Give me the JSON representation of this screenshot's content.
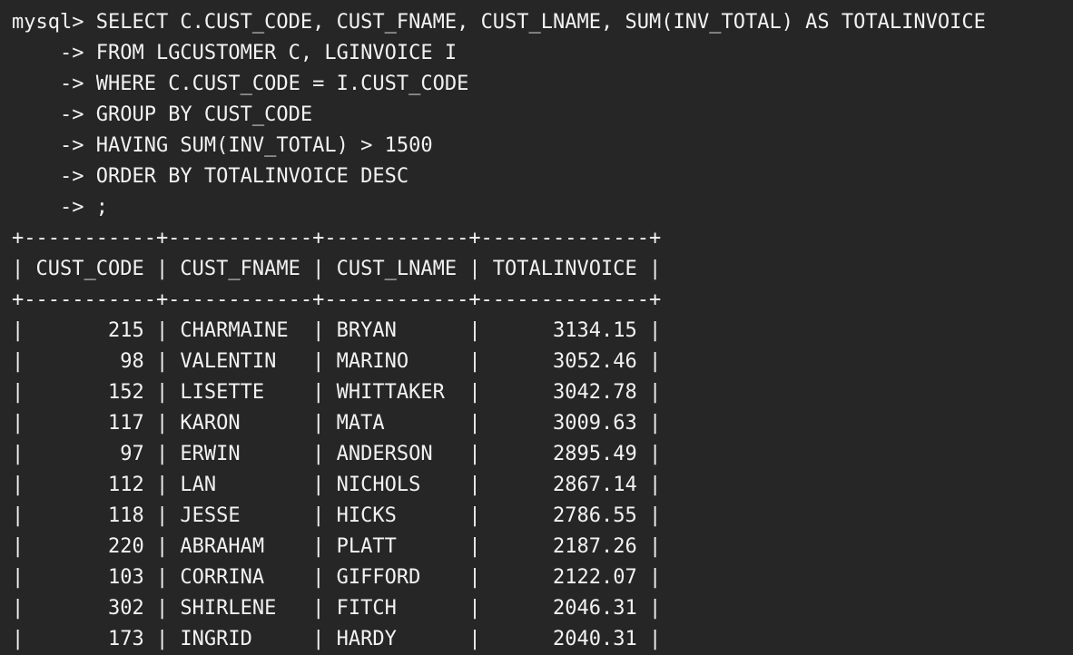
{
  "terminal": {
    "prompt": "mysql> ",
    "continuation_prompt": "    -> ",
    "query_lines": [
      "SELECT C.CUST_CODE, CUST_FNAME, CUST_LNAME, SUM(INV_TOTAL) AS TOTALINVOICE",
      "FROM LGCUSTOMER C, LGINVOICE I",
      "WHERE C.CUST_CODE = I.CUST_CODE",
      "GROUP BY CUST_CODE",
      "HAVING SUM(INV_TOTAL) > 1500",
      "ORDER BY TOTALINVOICE DESC",
      ";"
    ]
  },
  "result_table": {
    "border": "+-----------+------------+------------+--------------+",
    "header": "| CUST_CODE | CUST_FNAME | CUST_LNAME | TOTALINVOICE |",
    "columns": [
      "CUST_CODE",
      "CUST_FNAME",
      "CUST_LNAME",
      "TOTALINVOICE"
    ],
    "rows_text": [
      "|       215 | CHARMAINE  | BRYAN      |      3134.15 |",
      "|        98 | VALENTIN   | MARINO     |      3052.46 |",
      "|       152 | LISETTE    | WHITTAKER  |      3042.78 |",
      "|       117 | KARON      | MATA       |      3009.63 |",
      "|        97 | ERWIN      | ANDERSON   |      2895.49 |",
      "|       112 | LAN        | NICHOLS    |      2867.14 |",
      "|       118 | JESSE      | HICKS      |      2786.55 |",
      "|       220 | ABRAHAM    | PLATT      |      2187.26 |",
      "|       103 | CORRINA    | GIFFORD    |      2122.07 |",
      "|       302 | SHIRLENE   | FITCH      |      2046.31 |",
      "|       173 | INGRID     | HARDY      |      2040.31 |"
    ]
  },
  "colors": {
    "background": "#262626",
    "text": "#f2f2f2"
  }
}
